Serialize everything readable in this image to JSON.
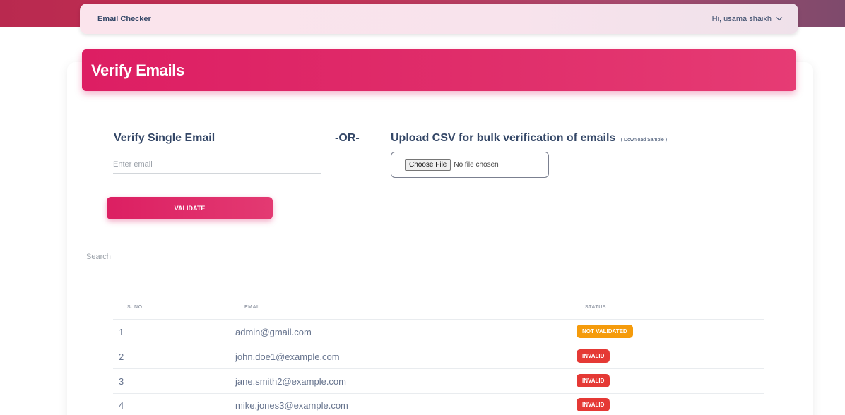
{
  "navbar": {
    "brand": "Email Checker",
    "user_greeting": "Hi, usama shaikh"
  },
  "card": {
    "title": "Verify Emails"
  },
  "single": {
    "title": "Verify Single Email",
    "placeholder": "Enter email",
    "validate_label": "VALIDATE"
  },
  "or_label": "-OR-",
  "csv": {
    "title": "Upload CSV for bulk verification of emails",
    "sample_link": "( Download Sample )",
    "choose_file": "Choose File",
    "no_file": "No file chosen"
  },
  "search": {
    "placeholder": "Search"
  },
  "table": {
    "headers": {
      "sno": "S. NO.",
      "email": "EMAIL",
      "status": "STATUS"
    },
    "rows": [
      {
        "sno": "1",
        "email": "admin@gmail.com",
        "status": "NOT VALIDATED",
        "status_color": "#f59b0b"
      },
      {
        "sno": "2",
        "email": "john.doe1@example.com",
        "status": "INVALID",
        "status_color": "#e53935"
      },
      {
        "sno": "3",
        "email": "jane.smith2@example.com",
        "status": "INVALID",
        "status_color": "#e53935"
      },
      {
        "sno": "4",
        "email": "mike.jones3@example.com",
        "status": "INVALID",
        "status_color": "#e53935"
      }
    ]
  },
  "colors": {
    "accent": "#dd1e63",
    "warning": "#f59b0b",
    "danger": "#e53935"
  },
  "icons": {
    "user_menu": "chevron-down-icon"
  }
}
